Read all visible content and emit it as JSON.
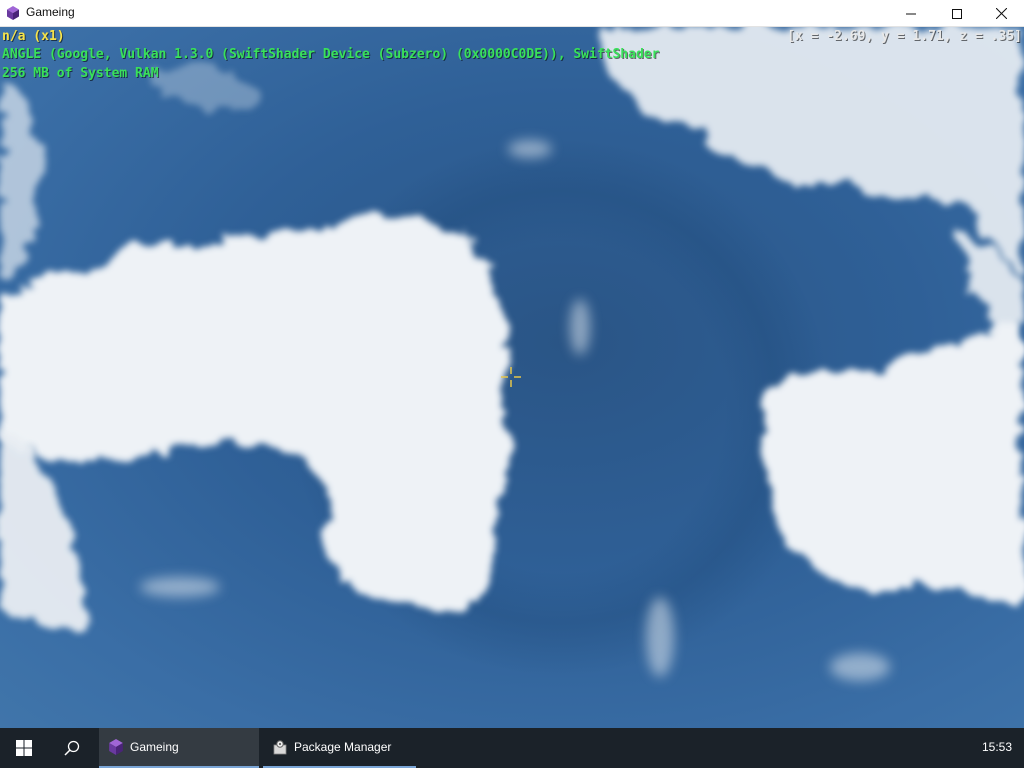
{
  "window": {
    "title": "Gameing",
    "icon": "purple-cube-icon",
    "controls": [
      "minimize-icon",
      "maximize-icon",
      "close-icon"
    ]
  },
  "hud": {
    "fps": "n/a (x1)",
    "gpu": "ANGLE (Google, Vulkan 1.3.0 (SwiftShader Device (Subzero) (0x0000C0DE)), SwiftShader",
    "ram": "256 MB of System RAM",
    "coords": "[x = -2.69, y = 1.71, z = .35]",
    "colors": {
      "fps": "#f5e34a",
      "info": "#39e15a",
      "coords": "#e8e8e8"
    }
  },
  "scene": {
    "crosshair_icon": "crosshair-icon",
    "sky_color": "#2f6097",
    "cloud_color": "#e9eef3"
  },
  "taskbar": {
    "start_icon": "windows-logo-icon",
    "search_icon": "search-icon",
    "items": [
      {
        "label": "Gameing",
        "icon": "purple-cube-icon",
        "active": true
      },
      {
        "label": "Package Manager",
        "icon": "gear-box-icon",
        "active": false
      }
    ],
    "clock": "15:53",
    "accent": "#7aa5d6"
  }
}
